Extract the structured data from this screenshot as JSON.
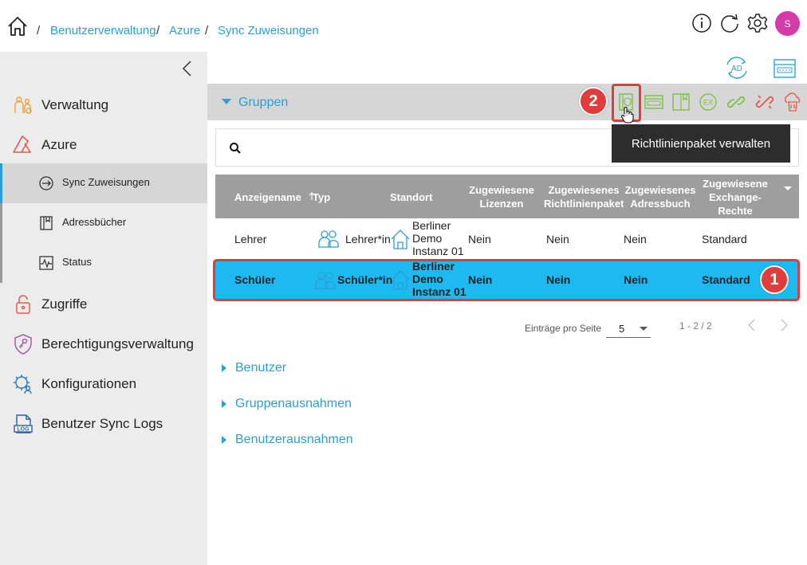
{
  "breadcrumb": {
    "items": [
      "Benutzerverwaltung",
      "Azure",
      "Sync Zuweisungen"
    ],
    "separator": "/"
  },
  "topbar": {
    "icons": [
      "info-icon",
      "refresh-icon",
      "settings-icon"
    ],
    "avatar_letter": "S",
    "avatar_color": "#d63aa5"
  },
  "sidebar": {
    "items": [
      {
        "label": "Verwaltung",
        "icon": "users-admin-icon"
      },
      {
        "label": "Azure",
        "icon": "azure-icon"
      },
      {
        "label": "Zugriffe",
        "icon": "lock-icon"
      },
      {
        "label": "Berechtigungsverwaltung",
        "icon": "shield-key-icon"
      },
      {
        "label": "Konfigurationen",
        "icon": "gear-people-icon"
      },
      {
        "label": "Benutzer Sync Logs",
        "icon": "log-icon"
      }
    ],
    "subitems": [
      {
        "label": "Sync Zuweisungen",
        "icon": "sync-icon",
        "active": true
      },
      {
        "label": "Adressbücher",
        "icon": "addressbook-icon"
      },
      {
        "label": "Status",
        "icon": "status-icon"
      }
    ]
  },
  "groups": {
    "title": "Gruppen",
    "tooltip": "Richtlinienpaket verwalten",
    "badge_toolbar": "2",
    "badge_row": "1"
  },
  "table": {
    "headers": {
      "name": "Anzeigename",
      "type": "Typ",
      "location": "Standort",
      "licenses": "Zugewiesene Lizenzen",
      "policy": "Zugewiesenes Richtlinienpaket",
      "addressbook": "Zugewiesenes Adressbuch",
      "exchange": "Zugewiesene Exchange-Rechte"
    },
    "rows": [
      {
        "name": "Lehrer",
        "type": "Lehrer*in",
        "location": "Berliner Demo Instanz 01",
        "licenses": "Nein",
        "policy": "Nein",
        "addressbook": "Nein",
        "exchange": "Standard"
      },
      {
        "name": "Schüler",
        "type": "Schüler*in",
        "location": "Berliner Demo Instanz 01",
        "licenses": "Nein",
        "policy": "Nein",
        "addressbook": "Nein",
        "exchange": "Standard"
      }
    ]
  },
  "pager": {
    "label": "Einträge pro Seite",
    "per_page": "5",
    "range": "1 - 2 / 2"
  },
  "sections": [
    "Benutzer",
    "Gruppenausnahmen",
    "Benutzerausnahmen"
  ],
  "colors": {
    "accent": "#2b9fd2",
    "selected_row": "#1dbaf2",
    "highlight": "#e13c3c",
    "green_icon": "#7cc142",
    "red_icon": "#e55b4b"
  }
}
